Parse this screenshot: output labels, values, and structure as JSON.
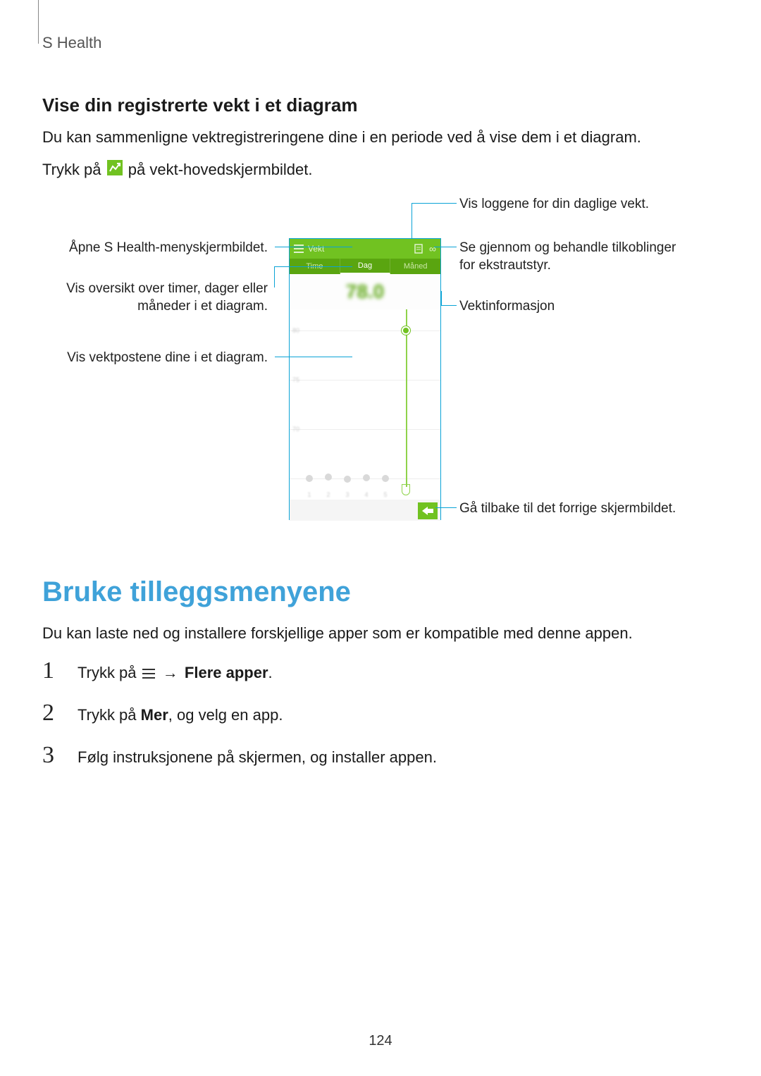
{
  "header": {
    "section": "S Health"
  },
  "section1": {
    "heading": "Vise din registrerte vekt i et diagram",
    "p1": "Du kan sammenligne vektregistreringene dine i en periode ved å vise dem i et diagram.",
    "p2_pre": "Trykk på",
    "p2_post": "på vekt-hovedskjermbildet."
  },
  "callouts": {
    "left1": "Åpne S Health-menyskjermbildet.",
    "left2": "Vis oversikt over timer, dager eller måneder i et diagram.",
    "left3": "Vis vektpostene dine i et diagram.",
    "right_top": "Vis loggene for din daglige vekt.",
    "right1": "Se gjennom og behandle tilkoblinger for ekstrautstyr.",
    "right2": "Vektinformasjon",
    "right_bottom": "Gå tilbake til det forrige skjermbildet."
  },
  "phone": {
    "title": "Vekt",
    "tabs": {
      "time": "Time",
      "day": "Dag",
      "month": "Måned"
    }
  },
  "section2": {
    "heading": "Bruke tilleggsmenyene",
    "intro": "Du kan laste ned og installere forskjellige apper som er kompatible med denne appen.",
    "step1_pre": "Trykk på",
    "step1_arrow": "→",
    "step1_bold": "Flere apper",
    "step1_post": ".",
    "step2_pre": "Trykk på ",
    "step2_bold": "Mer",
    "step2_post": ", og velg en app.",
    "step3": "Følg instruksjonene på skjermen, og installer appen."
  },
  "page_number": "124"
}
